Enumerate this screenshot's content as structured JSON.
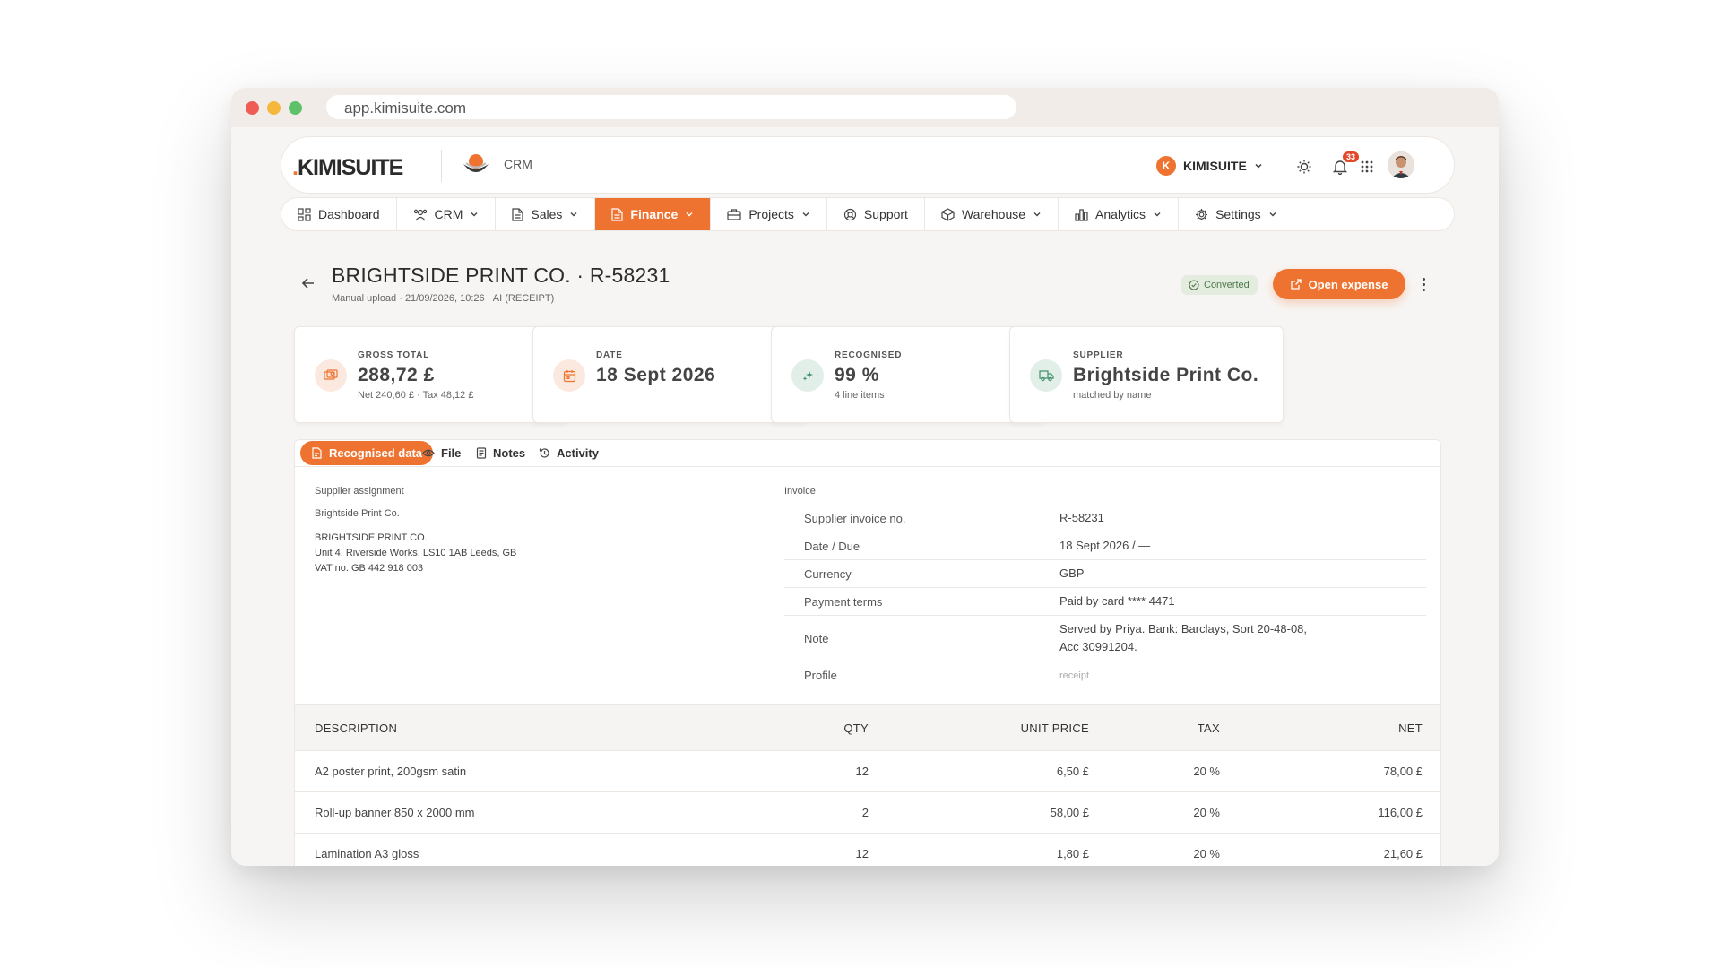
{
  "browser": {
    "url": "app.kimisuite.com"
  },
  "header": {
    "brand_dot": ".",
    "brand": "KIMISUITE",
    "app_name": "CRM",
    "org_initial": "K",
    "org_name": "KIMISUITE",
    "notification_count": "33"
  },
  "nav": [
    {
      "label": "Dashboard",
      "icon": "dashboard-icon"
    },
    {
      "label": "CRM",
      "icon": "users-icon"
    },
    {
      "label": "Sales",
      "icon": "document-icon"
    },
    {
      "label": "Finance",
      "icon": "document-icon",
      "active": true
    },
    {
      "label": "Projects",
      "icon": "briefcase-icon"
    },
    {
      "label": "Support",
      "icon": "lifebuoy-icon"
    },
    {
      "label": "Warehouse",
      "icon": "box-icon"
    },
    {
      "label": "Analytics",
      "icon": "bar-chart-icon"
    },
    {
      "label": "Settings",
      "icon": "gear-icon"
    }
  ],
  "page": {
    "title": "BRIGHTSIDE PRINT CO. · R-58231",
    "subtitle": "Manual upload · 21/09/2026, 10:26 · AI (RECEIPT)",
    "status": "Converted",
    "primary_action": "Open expense"
  },
  "cards": [
    {
      "label": "GROSS TOTAL",
      "value": "288,72 £",
      "sub": "Net 240,60 £ · Tax 48,12 £",
      "icon": "money-icon"
    },
    {
      "label": "DATE",
      "value": "18 Sept 2026",
      "sub": "",
      "icon": "calendar-icon"
    },
    {
      "label": "RECOGNISED",
      "value": "99 %",
      "sub": "4 line items",
      "icon": "sparkle-icon"
    },
    {
      "label": "SUPPLIER",
      "value": "Brightside Print Co.",
      "sub": "matched by name",
      "icon": "truck-icon"
    }
  ],
  "tabs": [
    "Recognised data",
    "File",
    "Notes",
    "Activity"
  ],
  "supplier": {
    "label": "Supplier assignment",
    "name": "Brightside Print Co.",
    "address_line1": "BRIGHTSIDE PRINT CO.",
    "address_line2": "Unit 4, Riverside Works, LS10 1AB Leeds, GB",
    "address_line3": "VAT no. GB 442 918 003"
  },
  "invoice": {
    "label": "Invoice",
    "rows": [
      {
        "k": "Supplier invoice no.",
        "v": "R-58231"
      },
      {
        "k": "Date / Due",
        "v": "18 Sept 2026 / —"
      },
      {
        "k": "Currency",
        "v": "GBP"
      },
      {
        "k": "Payment terms",
        "v": "Paid by card **** 4471"
      },
      {
        "k": "Note",
        "v": "Served by Priya. Bank: Barclays, Sort 20-48-08, Acc 30991204."
      },
      {
        "k": "Profile",
        "v": "receipt"
      }
    ]
  },
  "items": {
    "headers": {
      "desc": "DESCRIPTION",
      "qty": "QTY",
      "unit": "UNIT PRICE",
      "tax": "TAX",
      "net": "NET"
    },
    "rows": [
      {
        "desc": "A2 poster print, 200gsm satin",
        "qty": "12",
        "unit": "6,50 £",
        "tax": "20 %",
        "net": "78,00 £"
      },
      {
        "desc": "Roll-up banner 850 x 2000 mm",
        "qty": "2",
        "unit": "58,00 £",
        "tax": "20 %",
        "net": "116,00 £"
      },
      {
        "desc": "Lamination A3 gloss",
        "qty": "12",
        "unit": "1,80 £",
        "tax": "20 %",
        "net": "21,60 £"
      }
    ]
  },
  "colors": {
    "accent": "#ef7330",
    "success_bg": "#e3ecdf",
    "success_text": "#4f7a4a"
  }
}
